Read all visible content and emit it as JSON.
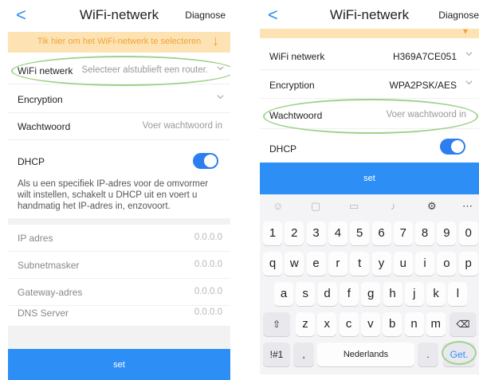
{
  "left": {
    "nav": {
      "back": "<",
      "title": "WiFi-netwerk",
      "diagnose": "Diagnose"
    },
    "banner": {
      "text": "Tik hier om het WiFi-netwerk te selecteren",
      "arrow": "↓"
    },
    "wifi": {
      "label": "WiFi netwerk",
      "placeholder": "Selecteer alstublieft een router."
    },
    "encryption": {
      "label": "Encryption"
    },
    "password": {
      "label": "Wachtwoord",
      "placeholder": "Voer wachtwoord in"
    },
    "dhcp": {
      "label": "DHCP",
      "on": true,
      "note": "Als u een specifiek IP-adres voor de omvormer wilt instellen, schakelt u DHCP uit en voert u handmatig het IP-adres in, enzovoort."
    },
    "ip_rows": [
      {
        "label": "IP adres",
        "value": "0.0.0.0"
      },
      {
        "label": "Subnetmasker",
        "value": "0.0.0.0"
      },
      {
        "label": "Gateway-adres",
        "value": "0.0.0.0"
      },
      {
        "label": "DNS Server",
        "value": "0.0.0.0"
      }
    ],
    "set_label": "set"
  },
  "right": {
    "nav": {
      "back": "<",
      "title": "WiFi-netwerk",
      "diagnose": "Diagnose"
    },
    "banner_arrow": "▾",
    "wifi": {
      "label": "WiFi netwerk",
      "value": "H369A7CE051"
    },
    "encryption": {
      "label": "Encryption",
      "value": "WPA2PSK/AES"
    },
    "password": {
      "label": "Wachtwoord",
      "placeholder": "Voer wachtwoord in"
    },
    "dhcp": {
      "label": "DHCP",
      "on": true
    },
    "set_label": "set",
    "keyboard": {
      "row1": [
        "1",
        "2",
        "3",
        "4",
        "5",
        "6",
        "7",
        "8",
        "9",
        "0"
      ],
      "row2": [
        "q",
        "w",
        "e",
        "r",
        "t",
        "y",
        "u",
        "i",
        "o",
        "p"
      ],
      "row3": [
        "a",
        "s",
        "d",
        "f",
        "g",
        "h",
        "j",
        "k",
        "l"
      ],
      "row4": [
        "z",
        "x",
        "c",
        "v",
        "b",
        "n",
        "m"
      ],
      "shift": "⇧",
      "backspace": "⌫",
      "sym": "!#1",
      "comma": ",",
      "space_label": "Nederlands",
      "period": ".",
      "go": "Get."
    },
    "colors": {
      "accent": "#2d8ef5",
      "highlight": "#9fd28c",
      "banner": "#fde3b4"
    }
  }
}
